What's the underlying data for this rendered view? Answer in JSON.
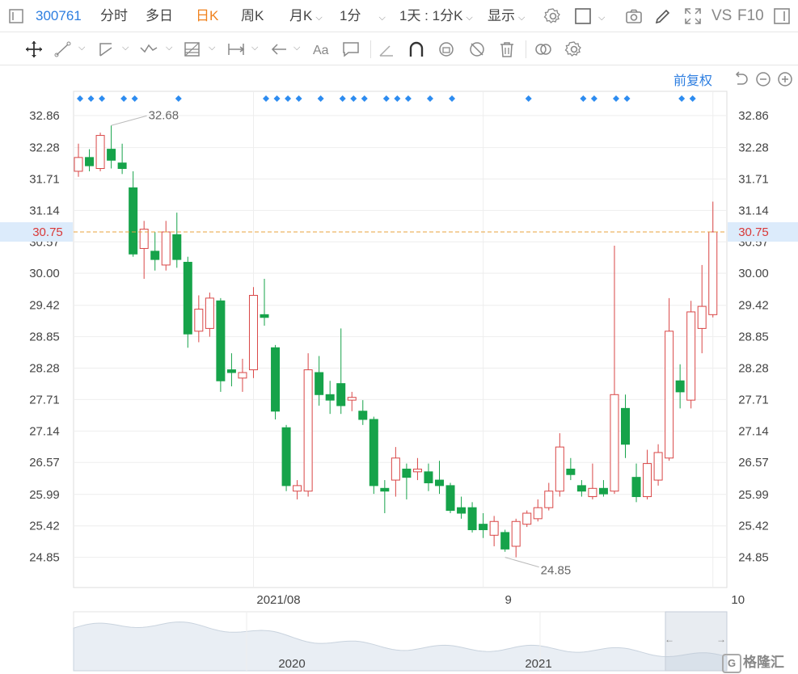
{
  "toolbar": {
    "code": "300761",
    "tabs": [
      "分时",
      "多日",
      "日K",
      "周K",
      "月K",
      "1分"
    ],
    "active_tab": "日K",
    "range_label": "1天 : 1分K",
    "display_label": "显示",
    "vs_label": "VS",
    "f10_label": "F10"
  },
  "adjust_label": "前复权",
  "chart_data": {
    "type": "candlestick",
    "y_ticks": [
      "32.86",
      "32.28",
      "31.71",
      "31.14",
      "30.57",
      "30.00",
      "29.42",
      "28.85",
      "28.28",
      "27.71",
      "27.14",
      "26.57",
      "25.99",
      "25.42",
      "24.85"
    ],
    "ylim": [
      24.29,
      33.43
    ],
    "x_labels": [
      {
        "i": 16,
        "label": "2021/08"
      },
      {
        "i": 37,
        "label": "9"
      },
      {
        "i": 58,
        "label": "10"
      }
    ],
    "last_price": "30.75",
    "last_price_value": 30.75,
    "high_marker": {
      "i": 3,
      "label": "32.68",
      "value": 32.68
    },
    "low_marker": {
      "i": 39,
      "label": "24.85",
      "value": 24.85
    },
    "event_marker_indices": [
      0,
      1,
      2,
      4,
      5,
      9,
      17,
      18,
      19,
      20,
      22,
      24,
      25,
      26,
      28,
      29,
      30,
      32,
      34,
      41,
      46,
      47,
      49,
      50,
      55,
      56
    ],
    "candles": [
      {
        "o": 31.85,
        "c": 32.1,
        "h": 32.35,
        "l": 31.75
      },
      {
        "o": 32.1,
        "c": 31.95,
        "h": 32.25,
        "l": 31.85
      },
      {
        "o": 31.9,
        "c": 32.5,
        "h": 32.55,
        "l": 31.85
      },
      {
        "o": 32.25,
        "c": 32.05,
        "h": 32.68,
        "l": 31.9
      },
      {
        "o": 32.0,
        "c": 31.9,
        "h": 32.35,
        "l": 31.8
      },
      {
        "o": 31.55,
        "c": 30.35,
        "h": 31.85,
        "l": 30.3
      },
      {
        "o": 30.45,
        "c": 30.8,
        "h": 30.95,
        "l": 29.9
      },
      {
        "o": 30.4,
        "c": 30.25,
        "h": 30.75,
        "l": 30.05
      },
      {
        "o": 30.15,
        "c": 30.75,
        "h": 30.95,
        "l": 30.05
      },
      {
        "o": 30.7,
        "c": 30.25,
        "h": 31.1,
        "l": 30.1
      },
      {
        "o": 30.2,
        "c": 28.9,
        "h": 30.3,
        "l": 28.65
      },
      {
        "o": 28.95,
        "c": 29.35,
        "h": 29.6,
        "l": 28.75
      },
      {
        "o": 29.0,
        "c": 29.55,
        "h": 29.65,
        "l": 28.85
      },
      {
        "o": 29.5,
        "c": 28.05,
        "h": 29.55,
        "l": 27.85
      },
      {
        "o": 28.25,
        "c": 28.2,
        "h": 28.55,
        "l": 27.95
      },
      {
        "o": 28.1,
        "c": 28.2,
        "h": 28.45,
        "l": 27.85
      },
      {
        "o": 28.25,
        "c": 29.6,
        "h": 29.75,
        "l": 28.1
      },
      {
        "o": 29.25,
        "c": 29.2,
        "h": 29.9,
        "l": 29.05
      },
      {
        "o": 28.65,
        "c": 27.5,
        "h": 28.7,
        "l": 27.35
      },
      {
        "o": 27.2,
        "c": 26.15,
        "h": 27.25,
        "l": 26.05
      },
      {
        "o": 26.05,
        "c": 26.15,
        "h": 26.25,
        "l": 25.9
      },
      {
        "o": 26.05,
        "c": 28.25,
        "h": 28.55,
        "l": 25.95
      },
      {
        "o": 28.2,
        "c": 27.8,
        "h": 28.5,
        "l": 27.6
      },
      {
        "o": 27.8,
        "c": 27.7,
        "h": 28.05,
        "l": 27.45
      },
      {
        "o": 28.0,
        "c": 27.6,
        "h": 29.0,
        "l": 27.45
      },
      {
        "o": 27.7,
        "c": 27.75,
        "h": 27.85,
        "l": 27.5
      },
      {
        "o": 27.5,
        "c": 27.35,
        "h": 27.7,
        "l": 27.25
      },
      {
        "o": 27.35,
        "c": 26.15,
        "h": 27.4,
        "l": 26.0
      },
      {
        "o": 26.1,
        "c": 26.05,
        "h": 26.25,
        "l": 25.65
      },
      {
        "o": 26.25,
        "c": 26.65,
        "h": 26.85,
        "l": 25.95
      },
      {
        "o": 26.45,
        "c": 26.3,
        "h": 26.55,
        "l": 25.9
      },
      {
        "o": 26.4,
        "c": 26.45,
        "h": 26.65,
        "l": 26.25
      },
      {
        "o": 26.4,
        "c": 26.2,
        "h": 26.55,
        "l": 26.05
      },
      {
        "o": 26.25,
        "c": 26.15,
        "h": 26.6,
        "l": 26.0
      },
      {
        "o": 26.15,
        "c": 25.7,
        "h": 26.2,
        "l": 25.65
      },
      {
        "o": 25.75,
        "c": 25.65,
        "h": 25.95,
        "l": 25.55
      },
      {
        "o": 25.75,
        "c": 25.35,
        "h": 25.85,
        "l": 25.3
      },
      {
        "o": 25.45,
        "c": 25.35,
        "h": 25.65,
        "l": 25.2
      },
      {
        "o": 25.25,
        "c": 25.5,
        "h": 25.6,
        "l": 25.05
      },
      {
        "o": 25.3,
        "c": 25.0,
        "h": 25.35,
        "l": 24.95
      },
      {
        "o": 25.05,
        "c": 25.5,
        "h": 25.55,
        "l": 24.85
      },
      {
        "o": 25.45,
        "c": 25.65,
        "h": 25.7,
        "l": 25.4
      },
      {
        "o": 25.55,
        "c": 25.75,
        "h": 25.9,
        "l": 25.5
      },
      {
        "o": 25.75,
        "c": 26.05,
        "h": 26.2,
        "l": 25.7
      },
      {
        "o": 26.05,
        "c": 26.85,
        "h": 27.1,
        "l": 25.95
      },
      {
        "o": 26.45,
        "c": 26.35,
        "h": 26.65,
        "l": 26.25
      },
      {
        "o": 26.15,
        "c": 26.05,
        "h": 26.25,
        "l": 25.95
      },
      {
        "o": 25.95,
        "c": 26.1,
        "h": 26.55,
        "l": 25.9
      },
      {
        "o": 26.1,
        "c": 26.0,
        "h": 26.25,
        "l": 25.95
      },
      {
        "o": 26.05,
        "c": 27.8,
        "h": 30.5,
        "l": 26.0
      },
      {
        "o": 27.55,
        "c": 26.9,
        "h": 27.8,
        "l": 26.65
      },
      {
        "o": 26.3,
        "c": 25.95,
        "h": 26.55,
        "l": 25.85
      },
      {
        "o": 25.95,
        "c": 26.55,
        "h": 26.8,
        "l": 25.9
      },
      {
        "o": 26.25,
        "c": 26.75,
        "h": 26.9,
        "l": 26.15
      },
      {
        "o": 26.65,
        "c": 28.95,
        "h": 29.55,
        "l": 26.6
      },
      {
        "o": 28.05,
        "c": 27.85,
        "h": 28.35,
        "l": 27.55
      },
      {
        "o": 27.7,
        "c": 29.3,
        "h": 29.5,
        "l": 27.55
      },
      {
        "o": 29.0,
        "c": 29.4,
        "h": 30.15,
        "l": 28.55
      },
      {
        "o": 29.25,
        "c": 30.75,
        "h": 31.3,
        "l": 29.2
      }
    ],
    "navigator": {
      "x_labels": [
        "2020",
        "2021"
      ]
    }
  },
  "colors": {
    "up": "#d94646",
    "down": "#16a34a",
    "marker": "#2d8cf0",
    "price_line": "#e8a33d",
    "price_badge_bg": "#dcebfb",
    "price_text": "#d93838",
    "grid": "#eeeeee",
    "axis": "#dddddd"
  },
  "logo_text": "格隆汇"
}
